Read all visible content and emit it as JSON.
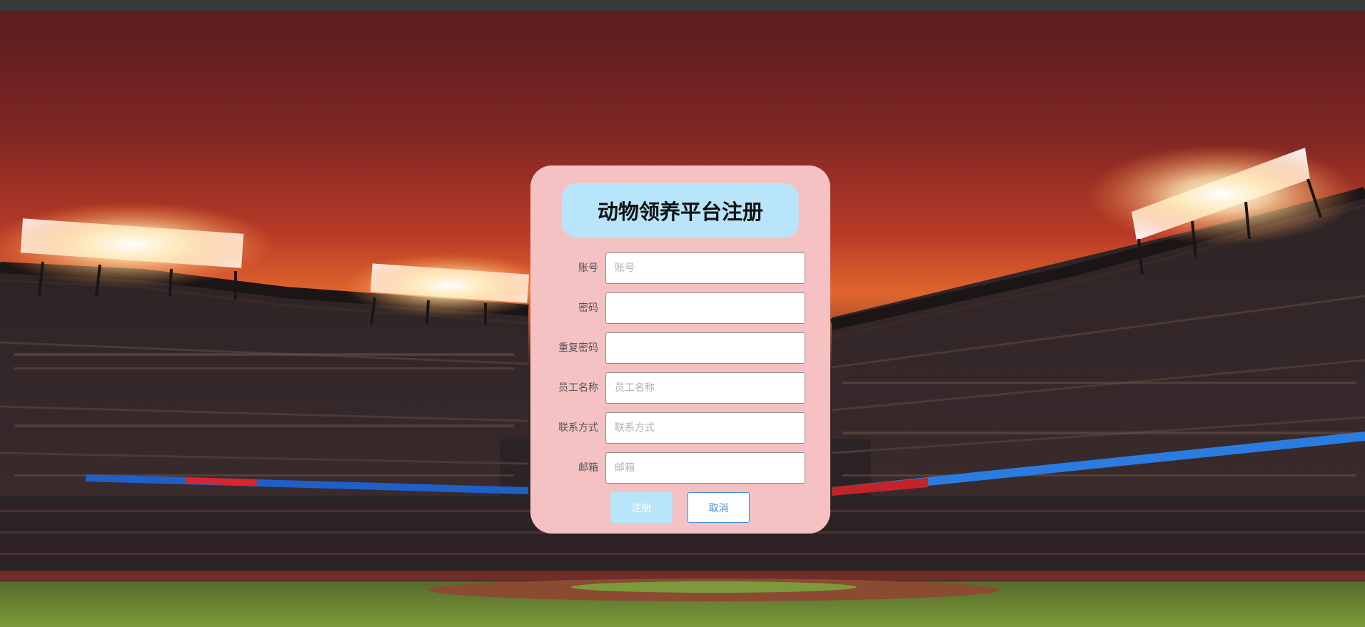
{
  "form": {
    "title": "动物领养平台注册",
    "fields": [
      {
        "label": "账号",
        "placeholder": "账号",
        "value": ""
      },
      {
        "label": "密码",
        "placeholder": "",
        "value": ""
      },
      {
        "label": "重复密码",
        "placeholder": "",
        "value": ""
      },
      {
        "label": "员工名称",
        "placeholder": "员工名称",
        "value": ""
      },
      {
        "label": "联系方式",
        "placeholder": "联系方式",
        "value": ""
      },
      {
        "label": "邮箱",
        "placeholder": "邮箱",
        "value": ""
      }
    ],
    "register_label": "注册",
    "cancel_label": "取消"
  },
  "colors": {
    "card_background": "#f5c1c3",
    "title_background": "#b9e5fb",
    "register_button": "#b9e5fb",
    "cancel_border": "#3d8fde"
  }
}
